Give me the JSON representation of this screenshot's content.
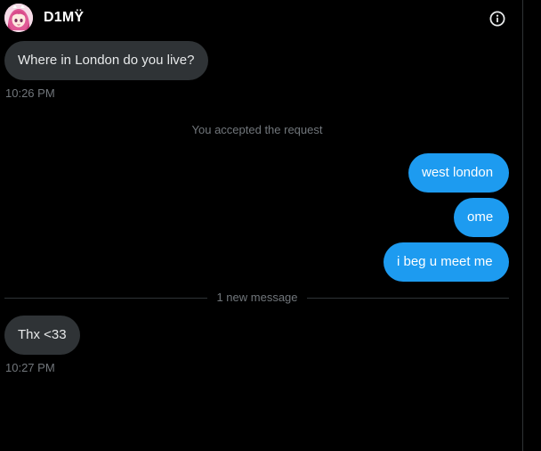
{
  "header": {
    "title": "D1MŸ",
    "avatar_icon": "anime-avatar-icon",
    "info_icon": "info-icon"
  },
  "messages": [
    {
      "direction": "incoming",
      "text": "Where in London do you live?",
      "time": "10:26 PM"
    },
    {
      "direction": "system",
      "text": "You accepted the request"
    },
    {
      "direction": "outgoing",
      "text": "west london"
    },
    {
      "direction": "outgoing",
      "text": "ome"
    },
    {
      "direction": "outgoing",
      "text": "i beg u meet me"
    },
    {
      "direction": "divider",
      "text": "1 new message"
    },
    {
      "direction": "incoming",
      "text": "Thx <33",
      "time": "10:27 PM"
    }
  ],
  "colors": {
    "background": "#000000",
    "incoming_bubble": "#2f3336",
    "outgoing_bubble": "#1d9bf0",
    "muted_text": "#71767b"
  }
}
